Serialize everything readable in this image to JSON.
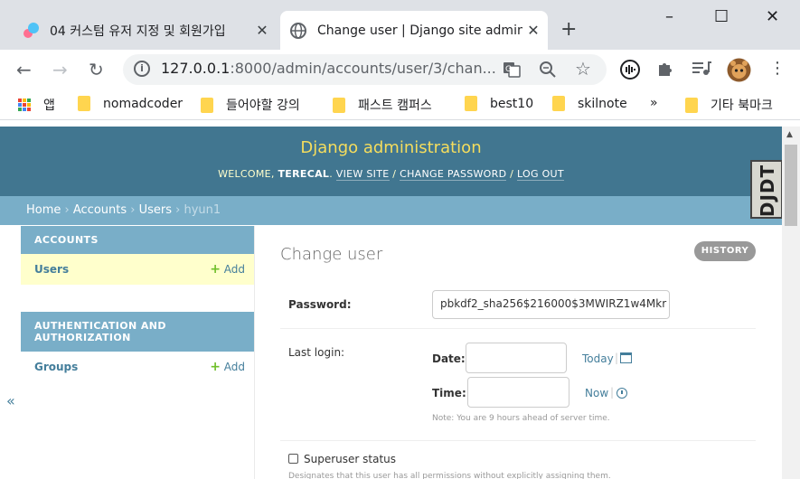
{
  "browser": {
    "tabs": [
      {
        "title": "04 커스텀 유저 지정 및 회원가입"
      },
      {
        "title": "Change user | Django site admin"
      }
    ],
    "new_tab": "+",
    "window": {
      "minimize": "–",
      "maximize": "☐",
      "close": "✕"
    },
    "url": {
      "host": "127.0.0.1",
      "rest": ":8000/admin/accounts/user/3/chan..."
    },
    "bookmarks": [
      {
        "label": "앱",
        "icon": "apps-grid-icon"
      },
      {
        "label": "nomadcoder",
        "icon": "folder-icon"
      },
      {
        "label": "들어야할 강의",
        "icon": "folder-icon"
      },
      {
        "label": "패스트 캠퍼스",
        "icon": "folder-icon"
      },
      {
        "label": "best10",
        "icon": "folder-icon"
      },
      {
        "label": "skilnote",
        "icon": "folder-icon"
      }
    ],
    "bookmarks_more": "»",
    "other_bookmarks": "기타 북마크"
  },
  "admin": {
    "brand": "Django administration",
    "welcome": "WELCOME,",
    "username": "TERECAL",
    "view_site": "VIEW SITE",
    "change_password": "CHANGE PASSWORD",
    "log_out": "LOG OUT",
    "breadcrumbs": [
      "Home",
      "Accounts",
      "Users",
      "hyun1"
    ],
    "sidebar": {
      "modules": [
        {
          "caption": "ACCOUNTS",
          "models": [
            {
              "name": "Users",
              "add": "Add"
            }
          ]
        },
        {
          "caption": "AUTHENTICATION AND AUTHORIZATION",
          "models": [
            {
              "name": "Groups",
              "add": "Add"
            }
          ]
        }
      ],
      "collapse": "«"
    },
    "title": "Change user",
    "history": "HISTORY",
    "password": {
      "label": "Password:",
      "value": "pbkdf2_sha256$216000$3MWIRZ1w4Mkr"
    },
    "last_login": {
      "label": "Last login:",
      "date_label": "Date:",
      "date_value": "",
      "today": "Today",
      "time_label": "Time:",
      "time_value": "",
      "now": "Now",
      "note": "Note: You are 9 hours ahead of server time."
    },
    "superuser": {
      "label": "Superuser status",
      "help": "Designates that this user has all permissions without explicitly assigning them."
    },
    "djdt": "DJDT"
  }
}
